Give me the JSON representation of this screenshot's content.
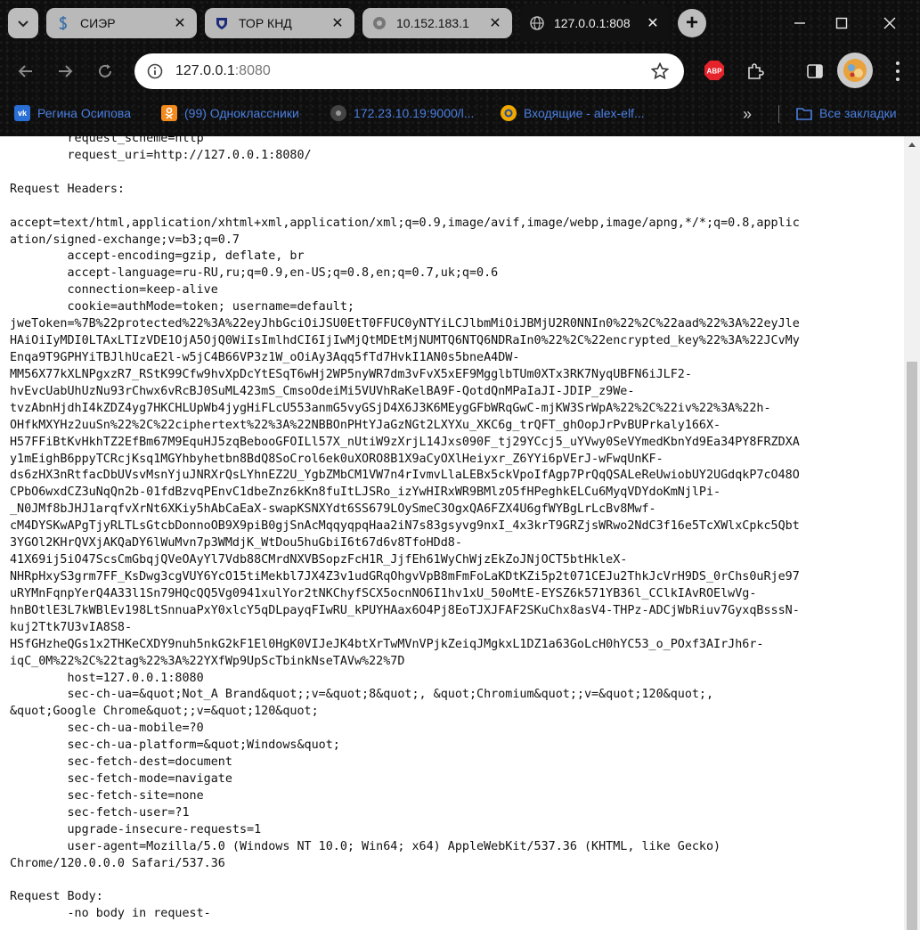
{
  "browser": {
    "tabs": [
      {
        "title": "СИЭР",
        "favicon": "dollar-icon",
        "active": false
      },
      {
        "title": "ТОР КНД",
        "favicon": "shield-icon",
        "active": false
      },
      {
        "title": "10.152.183.1",
        "favicon": "globe-icon",
        "active": false
      },
      {
        "title": "127.0.0.1:808",
        "favicon": "globe-icon",
        "active": true
      }
    ],
    "address": {
      "host": "127.0.0.1",
      "port": ":8080"
    },
    "bookmarks": [
      {
        "label": "Регина Осипова",
        "icon": "vk-icon",
        "color": "#2a6fd6"
      },
      {
        "label": "(99) Одноклассники",
        "icon": "ok-icon",
        "color": "#f28a1e"
      },
      {
        "label": "172.23.10.19:9000/l...",
        "icon": "globe-icon",
        "color": "#555555"
      },
      {
        "label": "Входящие - alex-elf...",
        "icon": "mail-icon",
        "color": "#f0a800"
      }
    ],
    "all_bookmarks": "Все закладки",
    "extension_badge": "ABP"
  },
  "page": {
    "lines": [
      "        request_scheme=http",
      "        request_uri=http://127.0.0.1:8080/",
      "",
      "Request Headers:",
      "",
      "accept=text/html,application/xhtml+xml,application/xml;q=0.9,image/avif,image/webp,image/apng,*/*;q=0.8,applic",
      "ation/signed-exchange;v=b3;q=0.7",
      "        accept-encoding=gzip, deflate, br",
      "        accept-language=ru-RU,ru;q=0.9,en-US;q=0.8,en;q=0.7,uk;q=0.6",
      "        connection=keep-alive",
      "        cookie=authMode=token; username=default;",
      "jweToken=%7B%22protected%22%3A%22eyJhbGciOiJSU0EtT0FFUC0yNTYiLCJlbmMiOiJBMjU2R0NNIn0%22%2C%22aad%22%3A%22eyJle",
      "HAiOiIyMDI0LTAxLTIzVDE1OjA5OjQ0WiIsImlhdCI6IjIwMjQtMDEtMjNUMTQ6NTQ6NDRaIn0%22%2C%22encrypted_key%22%3A%22JCvMy",
      "Enqa9T9GPHYiTBJlhUcaE2l-w5jC4B66VP3z1W_oOiAy3Aqq5fTd7HvkI1AN0s5bneA4DW-",
      "MM56X77kXLNPgxzR7_RStK99Cfw9hvXpDcYtESqT6wHj2WP5nyWR7dm3vFvX5xEF9MgglbTUm0XTx3RK7NyqUBFN6iJLF2-",
      "hvEvcUabUhUzNu93rChwx6vRcBJ0SuML423mS_CmsoOdeiMi5VUVhRaKelBA9F-QotdQnMPaIaJI-JDIP_z9We-",
      "tvzAbnHjdhI4kZDZ4yg7HKCHLUpWb4jygHiFLcU553anmG5vyGSjD4X6J3K6MEygGFbWRqGwC-mjKW3SrWpA%22%2C%22iv%22%3A%22h-",
      "OHfkMXYHz2uuSn%22%2C%22ciphertext%22%3A%22NBBOnPHtYJaGzNGt2LXYXu_XKC6g_trQFT_ghOopJrPvBUPrkaly166X-",
      "H57FFiBtKvHkhTZ2EfBm67M9EquHJ5zqBebooGFOILl57X_nUtiW9zXrjL14Jxs090F_tj29YCcj5_uYVwy0SeVYmedKbnYd9Ea34PY8FRZDXA",
      "y1mEighB6ppyTCRcjKsq1MGYhbyhetbn8BdQ8SoCrol6ek0uXORO8B1X9aCyOXlHeiyxr_Z6YYi6pVErJ-wFwqUnKF-",
      "ds6zHX3nRtfacDbUVsvMsnYjuJNRXrQsLYhnEZ2U_YgbZMbCM1VW7n4rIvmvLlaLEBx5ckVpoIfAgp7PrQqQSALeReUwiobUY2UGdqkP7cO48O",
      "CPbO6wxdCZ3uNqQn2b-01fdBzvqPEnvC1dbeZnz6kKn8fuItLJSRo_izYwHIRxWR9BMlzO5fHPeghkELCu6MyqVDYdoKmNjlPi-",
      "_N0JMf8bJHJ1arqfvXrNt6XKiy5hAbCaEaX-swapKSNXYdt6SS679LOySmeC3OgxQA6FZX4U6gfWYBgLrLcBv8Mwf-",
      "cM4DYSKwAPgTjyRLTLsGtcbDonnoOB9X9piB0gjSnAcMqqyqpqHaa2iN7s83gsyvg9nxI_4x3krT9GRZjsWRwo2NdC3f16e5TcXWlxCpkc5Qbt",
      "3YGOl2KHrQVXjAKQaDY6lWuMvn7p3WMdjK_WtDou5huGbiI6t67d6v8TfoHDd8-",
      "41X69ij5iO47ScsCmGbqjQVeOAyYl7Vdb88CMrdNXVBSopzFcH1R_JjfEh61WyChWjzEkZoJNjOCT5btHkleX-",
      "NHRpHxyS3grm7FF_KsDwg3cgVUY6YcO15tiMekbl7JX4Z3v1udGRqOhgvVpB8mFmFoLaKDtKZi5p2t071CEJu2ThkJcVrH9DS_0rChs0uRje97",
      "uRYMnFqnpYerQ4A33l1Sn79HQcQQ5Vg0941xulYor2tNKChyfSCX5ocnNO6I1hv1xU_50oMtE-EYSZ6k571YB36l_CClkIAvROElwVg-",
      "hnBOtlE3L7kWBlEv198LtSnnuaPxY0xlcY5qDLpayqFIwRU_kPUYHAax6O4Pj8EoTJXJFAF2SKuChx8asV4-THPz-ADCjWbRiuv7GyxqBsssN-",
      "kuj2Ttk7U3vIA8S8-",
      "HSfGHzheQGs1x2THKeCXDY9nuh5nkG2kF1El0HgK0VIJeJK4btXrTwMVnVPjkZeiqJMgkxL1DZ1a63GoLcH0hYC53_o_POxf3AIrJh6r-",
      "iqC_0M%22%2C%22tag%22%3A%22YXfWp9UpScTbinkNseTAVw%22%7D",
      "        host=127.0.0.1:8080",
      "        sec-ch-ua=&quot;Not_A Brand&quot;;v=&quot;8&quot;, &quot;Chromium&quot;;v=&quot;120&quot;,",
      "&quot;Google Chrome&quot;;v=&quot;120&quot;",
      "        sec-ch-ua-mobile=?0",
      "        sec-ch-ua-platform=&quot;Windows&quot;",
      "        sec-fetch-dest=document",
      "        sec-fetch-mode=navigate",
      "        sec-fetch-site=none",
      "        sec-fetch-user=?1",
      "        upgrade-insecure-requests=1",
      "        user-agent=Mozilla/5.0 (Windows NT 10.0; Win64; x64) AppleWebKit/537.36 (KHTML, like Gecko)",
      "Chrome/120.0.0.0 Safari/537.36",
      "",
      "Request Body:",
      "        -no body in request-"
    ]
  }
}
